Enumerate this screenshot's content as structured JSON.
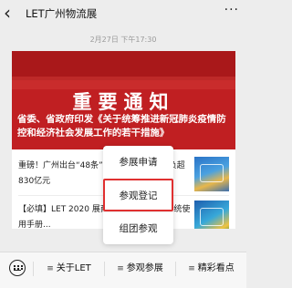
{
  "header": {
    "back_icon": "‹",
    "title": "LET广州物流展",
    "more_icon": "···"
  },
  "timestamp": "2月27日 下午17:30",
  "banner": {
    "title": "重要通知",
    "subtitle": "省委、省政府印发《关于统筹推进新冠肺炎疫情防控和经济社会发展工作的若干措施》"
  },
  "articles": [
    {
      "title": "重磅！广州出台“48条”措施，助力企业减负超830亿元"
    },
    {
      "title": "【必填】LET 2020 展商参展...《参展商系统使用手册..."
    }
  ],
  "popup_menu": {
    "items": [
      {
        "label": "参展申请"
      },
      {
        "label": "参观登记",
        "highlighted": true
      },
      {
        "label": "组团参观"
      }
    ]
  },
  "bottom_bar": {
    "keyboard_icon": "keyboard-icon",
    "tabs": [
      {
        "label": "关于LET"
      },
      {
        "label": "参观参展"
      },
      {
        "label": "精彩看点"
      }
    ]
  },
  "colors": {
    "banner_red": "#c01f22",
    "highlight_red": "#e03030",
    "background": "#ededed"
  }
}
